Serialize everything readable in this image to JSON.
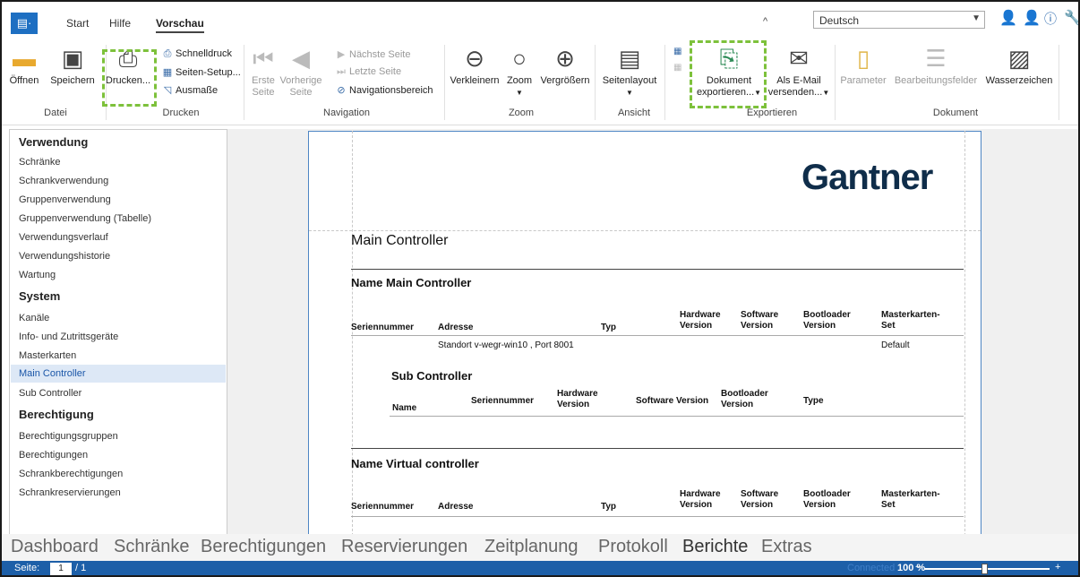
{
  "tabs": {
    "app_icon": "▤·",
    "start": "Start",
    "hilfe": "Hilfe",
    "vorschau": "Vorschau"
  },
  "language": {
    "value": "Deutsch"
  },
  "ribbon": {
    "oeffnen": "Öffnen",
    "speichern": "Speichern",
    "drucken": "Drucken...",
    "schnelldruck": "Schnelldruck",
    "seiten_setup": "Seiten-Setup...",
    "ausmasse": "Ausmaße",
    "erste_1": "Erste",
    "erste_2": "Seite",
    "vorherige_1": "Vorherige",
    "vorherige_2": "Seite",
    "naechste": "Nächste Seite",
    "letzte": "Letzte Seite",
    "navigationsbereich": "Navigationsbereich",
    "verkleinern": "Verkleinern",
    "zoom": "Zoom",
    "vergroessern": "Vergrößern",
    "seitenlayout": "Seitenlayout",
    "dokument_1": "Dokument",
    "dokument_2": "exportieren...",
    "email_1": "Als E-Mail",
    "email_2": "versenden...",
    "parameter": "Parameter",
    "bearbeitungsfelder": "Bearbeitungsfelder",
    "wasserzeichen": "Wasserzeichen",
    "groups": {
      "datei": "Datei",
      "drucken": "Drucken",
      "navigation": "Navigation",
      "zoom": "Zoom",
      "ansicht": "Ansicht",
      "exportieren": "Exportieren",
      "dokument": "Dokument"
    }
  },
  "nav": {
    "sec1": "Verwendung",
    "items1": [
      "Schränke",
      "Schrankverwendung",
      "Gruppenverwendung",
      "Gruppenverwendung (Tabelle)",
      "Verwendungsverlauf",
      "Verwendungshistorie",
      "Wartung"
    ],
    "sec2": "System",
    "items2": [
      "Kanäle",
      "Info- und Zutrittsgeräte",
      "Masterkarten",
      "Main Controller",
      "Sub Controller"
    ],
    "sec3": "Berechtigung",
    "items3": [
      "Berechtigungsgruppen",
      "Berechtigungen",
      "Schrankberechtigungen",
      "Schrankreservierungen"
    ]
  },
  "report": {
    "logo": "Gantner",
    "title": "Main Controller",
    "section1": "Name Main Controller",
    "cols": {
      "seriennummer": "Seriennummer",
      "adresse": "Adresse",
      "typ": "Typ",
      "hw1": "Hardware",
      "hw2": "Version",
      "sw1": "Software",
      "sw2": "Version",
      "bl1": "Bootloader",
      "bl2": "Version",
      "mk1": "Masterkarten-",
      "mk2": "Set"
    },
    "row1": {
      "adresse": "Standort v-wegr-win10 , Port 8001",
      "masterkarten": "Default"
    },
    "sub_title": "Sub Controller",
    "sub_cols": {
      "name": "Name",
      "seriennummer": "Seriennummer",
      "hw1": "Hardware",
      "hw2": "Version",
      "sw": "Software Version",
      "bl1": "Bootloader",
      "bl2": "Version",
      "type": "Type"
    },
    "section2": "Name Virtual controller"
  },
  "bottom_nav": [
    "Dashboard",
    "Schränke",
    "Berechtigungen",
    "Reservierungen",
    "Zeitplanung",
    "Protokoll",
    "Berichte",
    "Extras"
  ],
  "status": {
    "seite_label": "Seite:",
    "page": "1",
    "total": "/ 1",
    "connected": "Connected",
    "zoom": "100 %"
  },
  "colors": {
    "accent": "#1d5fa8",
    "highlight": "#7dc13b"
  }
}
